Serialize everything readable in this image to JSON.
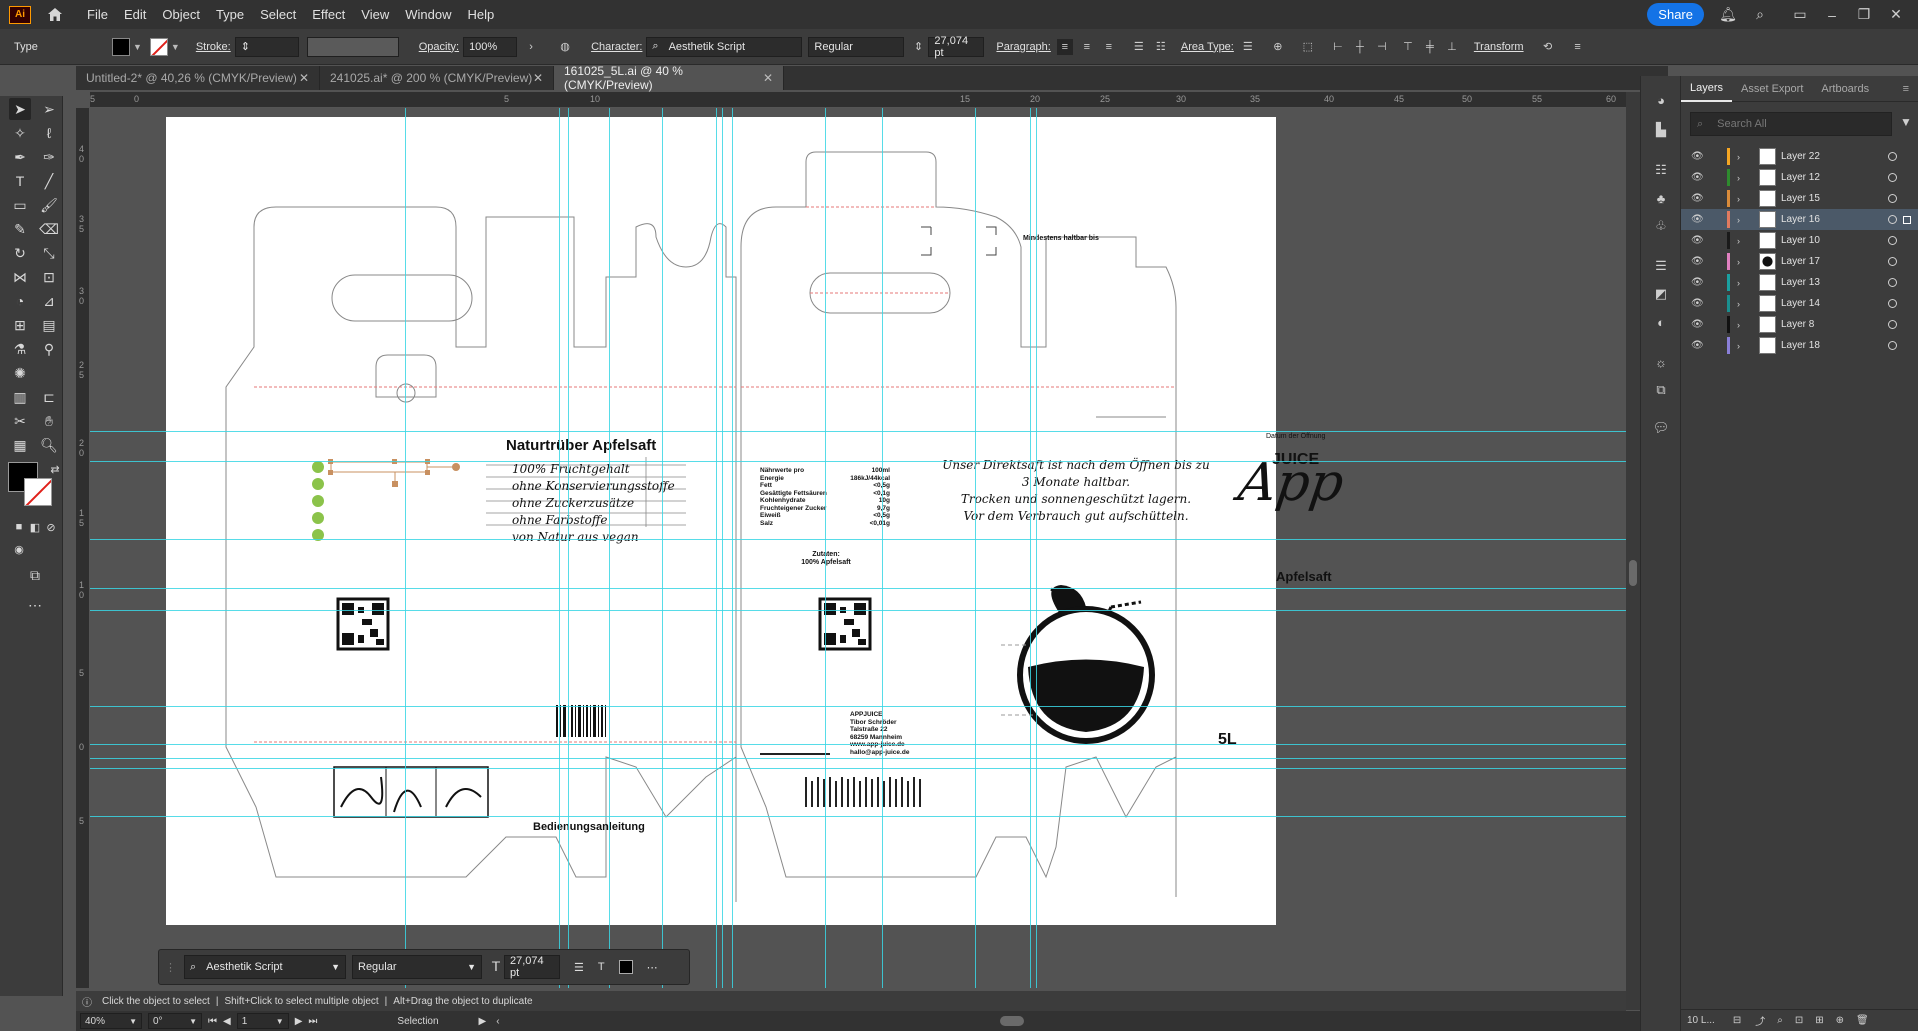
{
  "app": {
    "logo_text": "Ai",
    "menus": [
      "File",
      "Edit",
      "Object",
      "Type",
      "Select",
      "Effect",
      "View",
      "Window",
      "Help"
    ],
    "share_label": "Share"
  },
  "control": {
    "tool_name": "Type",
    "stroke_label": "Stroke:",
    "opacity_label": "Opacity:",
    "opacity_value": "100%",
    "character_label": "Character:",
    "font_family": "Aesthetik Script",
    "font_style": "Regular",
    "font_size": "27,074 pt",
    "paragraph_label": "Paragraph:",
    "area_type_label": "Area Type:",
    "transform_label": "Transform",
    "fill_color": "#000000"
  },
  "tabs": [
    {
      "label": "Untitled-2* @ 40,26 % (CMYK/Preview)"
    },
    {
      "label": "241025.ai* @ 200 % (CMYK/Preview)"
    },
    {
      "label": "161025_5L.ai @ 40 % (CMYK/Preview)"
    }
  ],
  "ruler": {
    "top_ticks": [
      "5",
      "0",
      "5",
      "10",
      "15",
      "20",
      "25",
      "30",
      "35",
      "40",
      "45",
      "50",
      "55",
      "60"
    ],
    "left_ticks": [
      "4",
      "0",
      "3",
      "5",
      "3",
      "0",
      "2",
      "5",
      "2",
      "0",
      "1",
      "5",
      "1",
      "0",
      "5",
      "0",
      "5"
    ]
  },
  "artwork": {
    "product_title": "Naturtrüber Apfelsaft",
    "features": [
      "100% Fruchtgehalt",
      "ohne Konservierungsstoffe",
      "ohne Zuckerzusätze",
      "ohne Farbstoffe",
      "von Natur aus vegan"
    ],
    "nutrition_header": "Nährwerte pro",
    "nutrition_header_value": "100ml",
    "nutrition": [
      {
        "label": "Energie",
        "value": "186kJ/44kcal"
      },
      {
        "label": "Fett",
        "value": "<0,5g"
      },
      {
        "label": "Gesättigte Fettsäuren",
        "value": "<0,1g"
      },
      {
        "label": "Kohlenhydrate",
        "value": "10g"
      },
      {
        "label": "Fruchteigener Zucker",
        "value": "9,7g"
      },
      {
        "label": "Eiweiß",
        "value": "<0,5g"
      },
      {
        "label": "Salz",
        "value": "<0,01g"
      }
    ],
    "ingredients_label": "Zutaten:",
    "ingredients_value": "100% Apfelsaft",
    "shelf_life_label": "Mindestens haltbar bis",
    "opening_date_label": "Datum der Öffnung",
    "description_lines": [
      "Unser Direktsaft ist nach dem Öffnen bis zu",
      "3 Monate haltbar.",
      "Trocken und sonnengeschützt lagern.",
      "Vor dem Verbrauch gut aufschütteln."
    ],
    "brand_top": "JUICE",
    "brand_main": "App",
    "brand_sub": "Apfelsaft",
    "volume": "5L",
    "company_lines": [
      "APPJUICE",
      "Tibor Schröder",
      "Talstraße 22",
      "68259 Mannheim",
      "www.app-juice.de",
      "hallo@app-juice.de"
    ],
    "instructions_label": "Bedienungsanleitung"
  },
  "layers_panel": {
    "tabs": [
      "Layers",
      "Asset Export",
      "Artboards"
    ],
    "search_placeholder": "Search All",
    "layers": [
      {
        "name": "Layer 22",
        "color": "#f5a623"
      },
      {
        "name": "Layer 12",
        "color": "#2e8b2e"
      },
      {
        "name": "Layer 15",
        "color": "#d98b3a"
      },
      {
        "name": "Layer 16",
        "color": "#e07a5f"
      },
      {
        "name": "Layer 10",
        "color": "#1a1a1a"
      },
      {
        "name": "Layer 17",
        "color": "#e080c0"
      },
      {
        "name": "Layer 13",
        "color": "#1aa0a0"
      },
      {
        "name": "Layer 14",
        "color": "#1a8f8f"
      },
      {
        "name": "Layer 8",
        "color": "#111111"
      },
      {
        "name": "Layer 18",
        "color": "#8a7fd8"
      }
    ],
    "footer_count": "10 L..."
  },
  "floating_char": {
    "font_family": "Aesthetik Script",
    "font_style": "Regular",
    "font_size": "27,074 pt"
  },
  "status": {
    "hint_1": "Click the object to select",
    "hint_2": "Shift+Click to select multiple object",
    "hint_3": "Alt+Drag the object to duplicate",
    "zoom": "40%",
    "rotation": "0°",
    "artboard_num": "1",
    "tool_status": "Selection"
  }
}
